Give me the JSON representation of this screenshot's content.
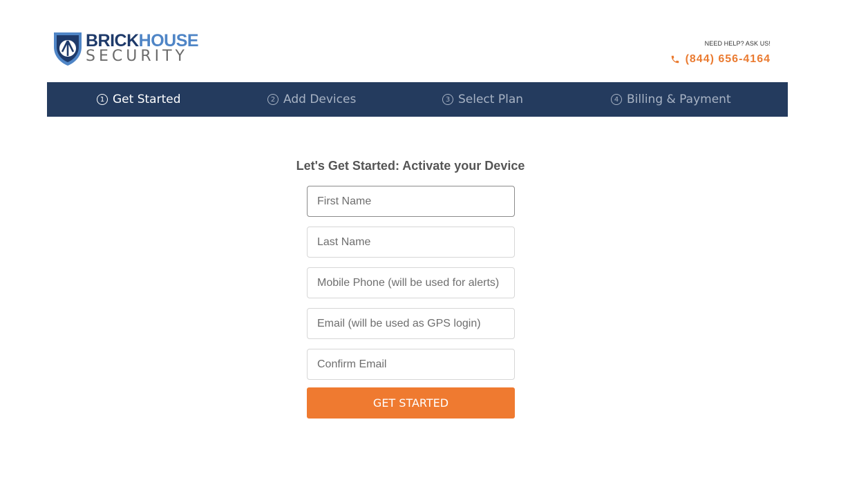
{
  "brand": {
    "name_part1": "BRICK",
    "name_part2": "HOUSE",
    "name_line2": "SECURITY",
    "colors": {
      "navy": "#1e3a6a",
      "blue": "#4f85c6",
      "gray": "#6b6b6b"
    }
  },
  "help": {
    "label": "NEED HELP? ASK US!",
    "phone": "(844) 656-4164",
    "phone_icon": "phone-icon",
    "phone_color": "#ea7b31"
  },
  "steps": [
    {
      "number": "1",
      "label": "Get Started",
      "active": true
    },
    {
      "number": "2",
      "label": "Add Devices",
      "active": false
    },
    {
      "number": "3",
      "label": "Select Plan",
      "active": false
    },
    {
      "number": "4",
      "label": "Billing & Payment",
      "active": false
    }
  ],
  "steps_bar_color": "#243b5e",
  "form": {
    "title": "Let's Get Started: Activate your Device",
    "fields": {
      "first_name": {
        "placeholder": "First Name",
        "value": ""
      },
      "last_name": {
        "placeholder": "Last Name",
        "value": ""
      },
      "mobile_phone": {
        "placeholder": "Mobile Phone (will be used for alerts)",
        "value": ""
      },
      "email": {
        "placeholder": "Email (will be used as GPS login)",
        "value": ""
      },
      "confirm_email": {
        "placeholder": "Confirm Email",
        "value": ""
      }
    },
    "submit_label": "GET STARTED",
    "submit_color": "#ef7a30"
  }
}
